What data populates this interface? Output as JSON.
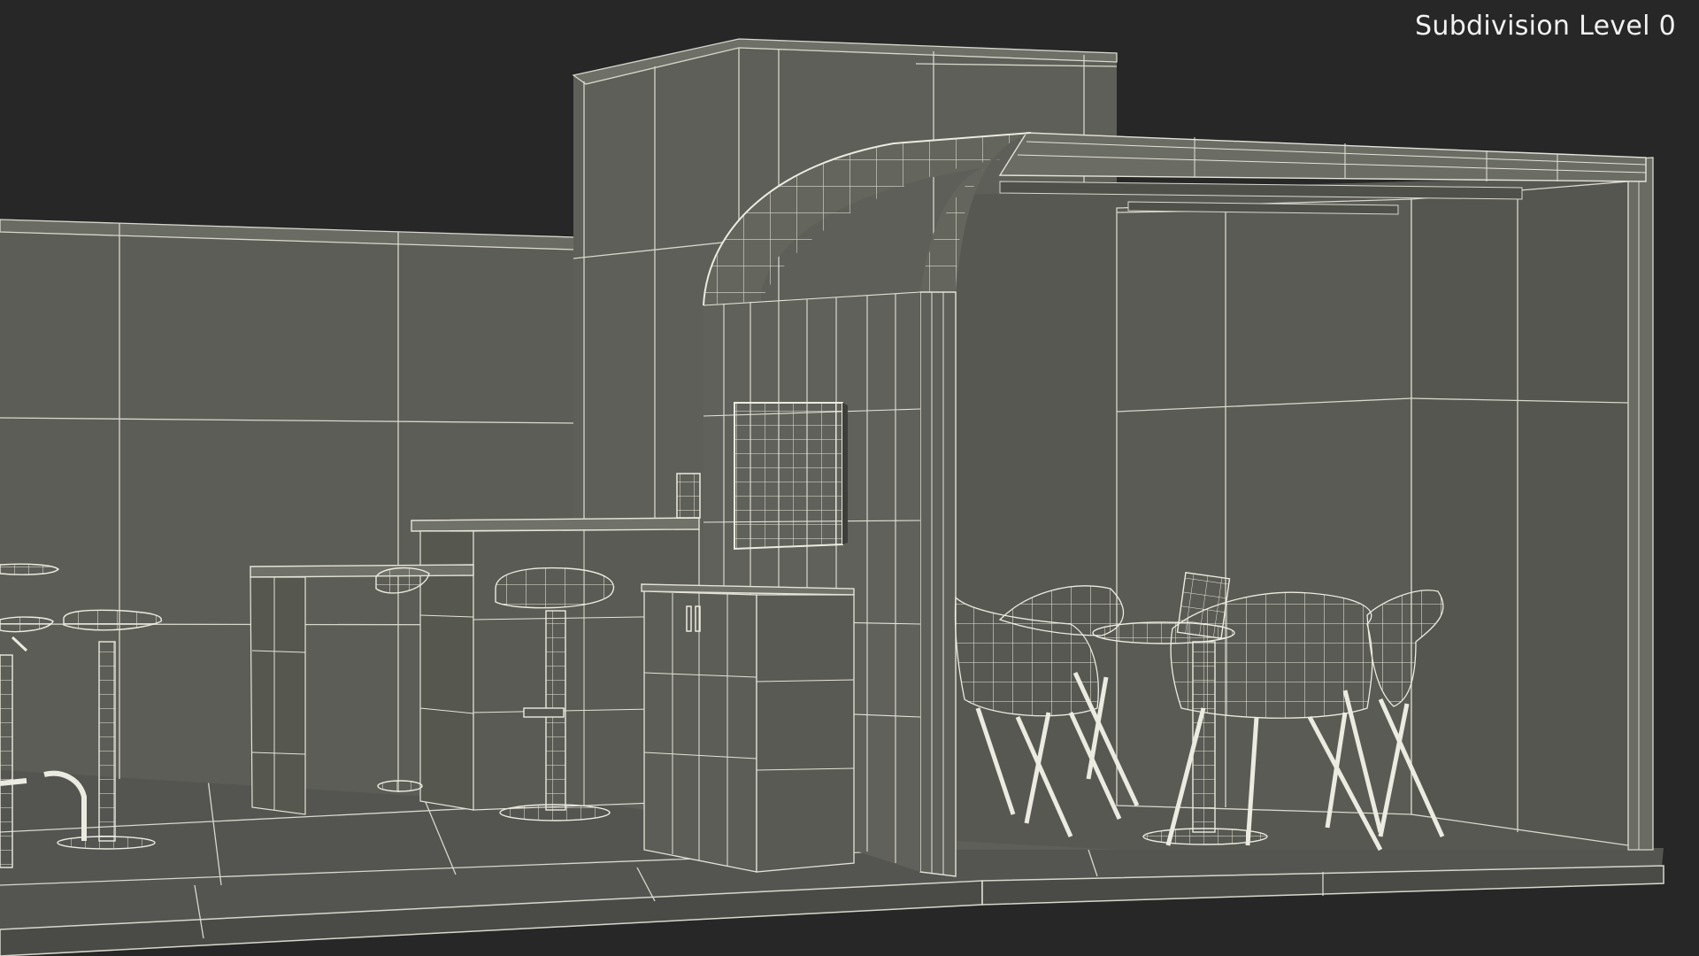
{
  "viewport": {
    "overlay_label": "Subdivision Level 0",
    "background_color": "#272727",
    "surface_color": "#5b5c55",
    "wire_color": "#e6e5db"
  }
}
